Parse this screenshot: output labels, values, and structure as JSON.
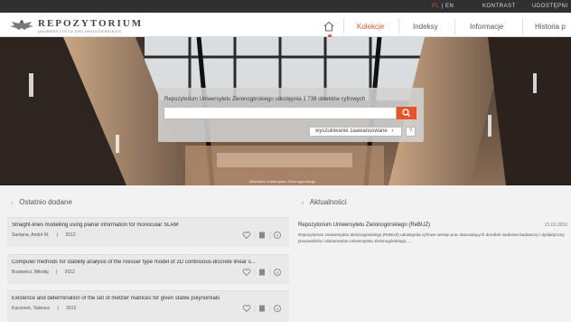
{
  "topbar": {
    "lang_pl": "PL",
    "lang_sep": "|",
    "lang_en": "EN",
    "contrast": "KONTRAST",
    "accessibility": "UDOSTĘPNI"
  },
  "brand": {
    "name": "REPOZYTORIUM",
    "subtitle": "UNIWERSYTETU ZIELONOGÓRSKIEGO"
  },
  "nav": {
    "items": [
      {
        "label": "Kolekcje"
      },
      {
        "label": "Indeksy"
      },
      {
        "label": "Informacje"
      },
      {
        "label": "Historia p"
      }
    ]
  },
  "search": {
    "heading": "Repozytorium Uniwersytetu Zielonogórskiego udostępnia 1 738 obiektów cyfrowych",
    "value": "",
    "advanced_label": "wyszukiwanie zaawansowane",
    "advanced_chevron": "›",
    "help_label": "?"
  },
  "hero": {
    "caption": "Biblioteka Uniwersytetu Zielonogórskiego"
  },
  "recent": {
    "heading": "Ostatnio dodane",
    "chevron": "›",
    "items": [
      {
        "title": "Straight-lines modelling using planar information for monocular SLAM",
        "author": "Santana, André M.",
        "sep": "|",
        "year": "2012"
      },
      {
        "title": "Computer methods for stability analysis of the roesser type model of 2D continuous-discrete linear s...",
        "author": "Busłowicz, Mikołaj",
        "sep": "|",
        "year": "2012"
      },
      {
        "title": "Existence and determination of the set of metzler matrices for given stable polynomials",
        "author": "Kaczorek, Tadeusz",
        "sep": "|",
        "year": "2012"
      }
    ]
  },
  "news": {
    "heading": "Aktualności",
    "chevron": "›",
    "item": {
      "title": "Repozytorium Uniwersytetu Zielonogórskiego (ReBUZ)",
      "date": "21.01.2016",
      "body": "Repozytorium Uniwersytetu Zielonogórskiego (ReBUZ) udostępnia cyfrowe wersje prac stanowiących dorobek naukowo-badawczy i dydaktyczny pracowników i doktorantów Uniwersytetu Zielonogórskiego; ..."
    }
  },
  "colors": {
    "accent": "#e8542a",
    "topbar": "#303030"
  }
}
